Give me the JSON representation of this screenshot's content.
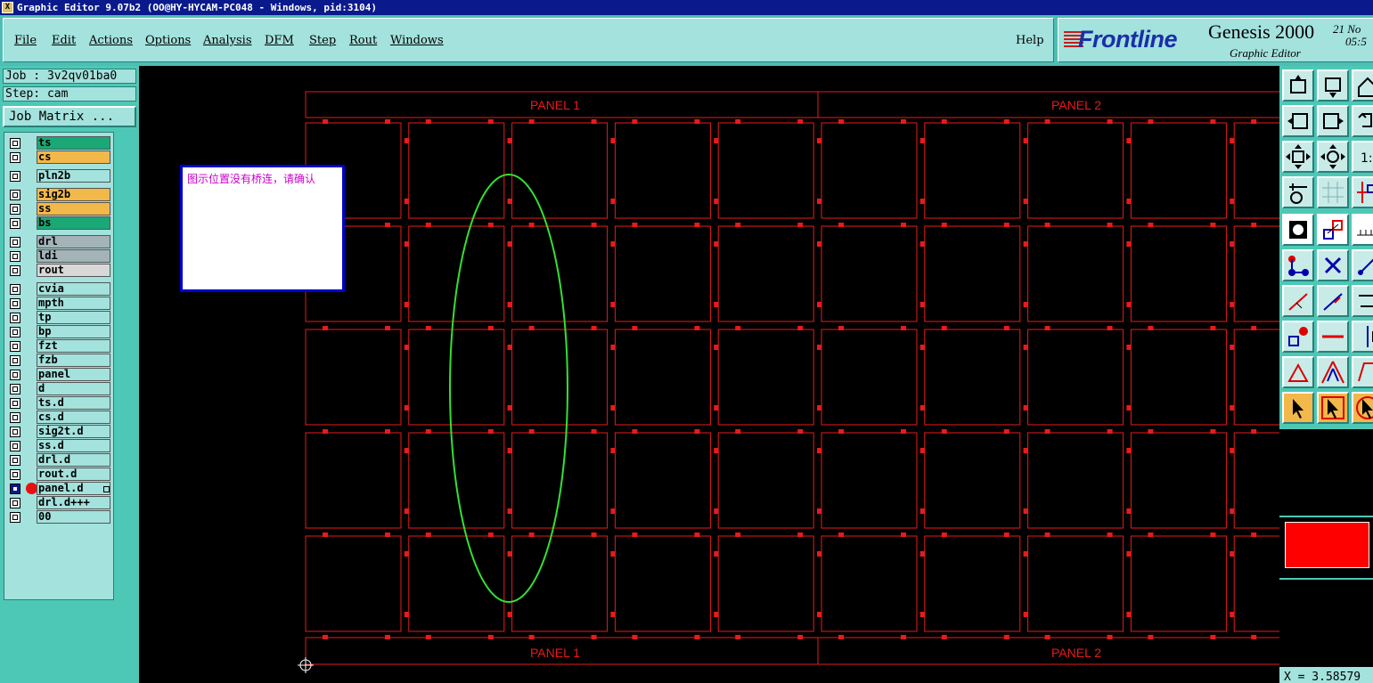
{
  "window": {
    "title": "Graphic Editor 9.07b2 (OO@HY-HYCAM-PC048 - Windows, pid:3104)"
  },
  "menu": {
    "items": [
      "File",
      "Edit",
      "Actions",
      "Options",
      "Analysis",
      "DFM",
      "Step",
      "Rout",
      "Windows"
    ],
    "help": "Help"
  },
  "logo": {
    "brand": "Frontline",
    "product": "Genesis 2000",
    "subtitle": "Graphic Editor",
    "date": "21 No",
    "time": "05:5"
  },
  "job": {
    "job_label": "Job : 3v2qv01ba0",
    "step_label": "Step: cam",
    "job_matrix_button": "Job Matrix ..."
  },
  "layers": [
    {
      "name": "ts",
      "color": "#1aa876"
    },
    {
      "name": "cs",
      "color": "#f2b84a"
    },
    {
      "name": "pln2b",
      "color": "#a3e2dd"
    },
    {
      "name": "sig2b",
      "color": "#f2b84a"
    },
    {
      "name": "ss",
      "color": "#f2b84a"
    },
    {
      "name": "bs",
      "color": "#1aa876"
    },
    {
      "name": "drl",
      "color": "#a3b3b8"
    },
    {
      "name": "ldi",
      "color": "#a3b3b8"
    },
    {
      "name": "rout",
      "color": "#d8d8d8"
    },
    {
      "name": "cvia",
      "color": "#a3e2dd"
    },
    {
      "name": "mpth",
      "color": "#a3e2dd"
    },
    {
      "name": "tp",
      "color": "#a3e2dd"
    },
    {
      "name": "bp",
      "color": "#a3e2dd"
    },
    {
      "name": "fzt",
      "color": "#a3e2dd"
    },
    {
      "name": "fzb",
      "color": "#a3e2dd"
    },
    {
      "name": "panel",
      "color": "#a3e2dd"
    },
    {
      "name": "d",
      "color": "#a3e2dd"
    },
    {
      "name": "ts.d",
      "color": "#a3e2dd"
    },
    {
      "name": "cs.d",
      "color": "#a3e2dd"
    },
    {
      "name": "sig2t.d",
      "color": "#a3e2dd"
    },
    {
      "name": "ss.d",
      "color": "#a3e2dd"
    },
    {
      "name": "drl.d",
      "color": "#a3e2dd"
    },
    {
      "name": "rout.d",
      "color": "#a3e2dd"
    },
    {
      "name": "panel.d",
      "color": "#a3e2dd",
      "active": true
    },
    {
      "name": "drl.d+++",
      "color": "#a3e2dd"
    },
    {
      "name": "00",
      "color": "#a3e2dd"
    }
  ],
  "canvas": {
    "panel_labels": [
      "PANEL 1",
      "PANEL 2"
    ],
    "grid_color": "#e81a1a",
    "text_color": "#e81a1a",
    "highlight_color": "#33e033",
    "columns": 10,
    "rows": 5
  },
  "annotation": {
    "text": "图示位置没有桥连，请确认"
  },
  "tools": [
    "snap-to-top-icon",
    "snap-to-bottom-icon",
    "home-icon",
    "snap-to-left-icon",
    "snap-to-right-icon",
    "undo-view-icon",
    "fit-all-icon",
    "fit-profile-icon",
    "zoom-ratio-icon",
    "measure-icon",
    "grid-icon",
    "layer-cross-icon",
    "select-feature-icon",
    "transform-icon",
    "ruler-icon",
    "net-connect-icon",
    "delete-icon",
    "move-icon",
    "add-line-icon",
    "edit-line-icon",
    "swap-icon",
    "add-pad-icon",
    "minus-icon",
    "align-icon",
    "add-surface-icon",
    "triangle-icon",
    "edit-surface-icon",
    "pointer-icon",
    "pointer-box-icon",
    "pointer-no-icon"
  ],
  "status": {
    "coordinate": "X = 3.58579"
  }
}
